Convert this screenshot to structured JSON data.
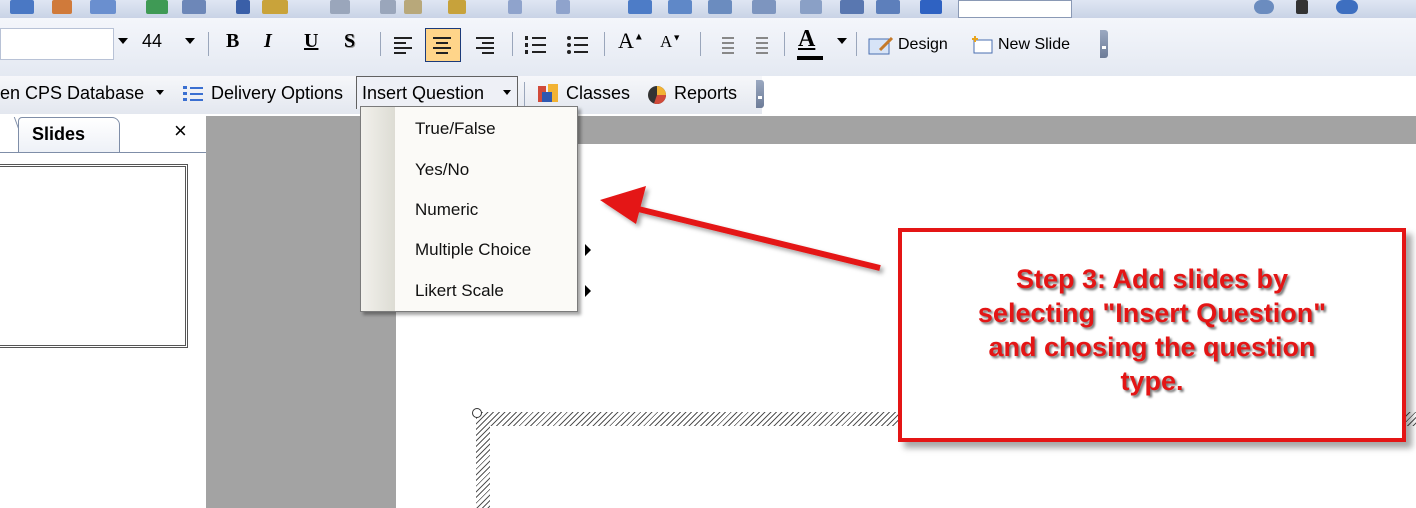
{
  "formatting_bar": {
    "font_size": "44",
    "bold": "B",
    "italic": "I",
    "underline": "U",
    "shadow": "S",
    "font_color_label": "A",
    "design_label": "Design",
    "new_slide_label": "New Slide"
  },
  "cps_bar": {
    "database_label": "en CPS Database",
    "delivery_options_label": "Delivery Options",
    "insert_question_label": "Insert Question",
    "classes_label": "Classes",
    "reports_label": "Reports"
  },
  "left_pane": {
    "tab_label": "Slides",
    "close_glyph": "×"
  },
  "insert_menu": {
    "items": [
      {
        "label": "True/False",
        "submenu": false
      },
      {
        "label": "Yes/No",
        "submenu": false
      },
      {
        "label": "Numeric",
        "submenu": false
      },
      {
        "label": "Multiple Choice",
        "submenu": true
      },
      {
        "label": "Likert Scale",
        "submenu": true
      }
    ]
  },
  "callout": {
    "text_line1": "Step 3: Add slides by",
    "text_line2": "selecting \"Insert Question\"",
    "text_line3": "and chosing the question",
    "text_line4": "type."
  },
  "colors": {
    "annotation_red": "#e41515",
    "toolbar_blue": "#dfe6f3",
    "workspace_gray": "#a3a3a3"
  }
}
